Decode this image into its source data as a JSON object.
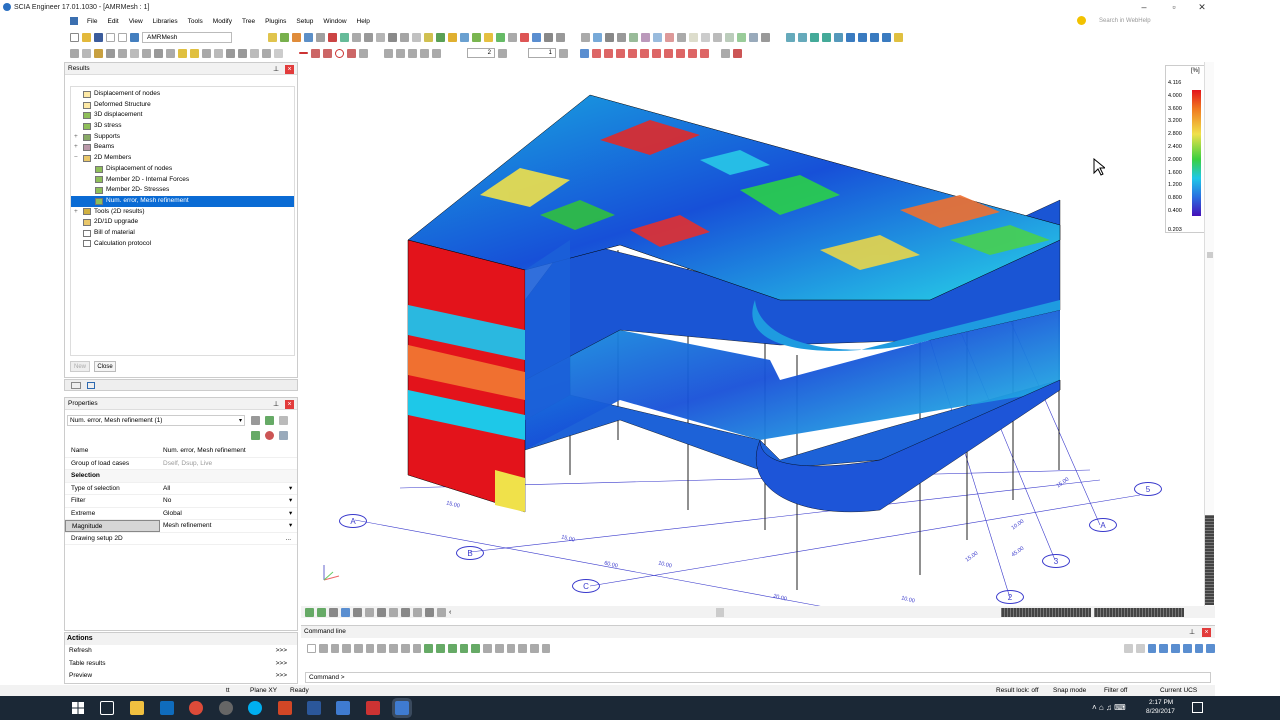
{
  "window": {
    "title": "SCIA Engineer 17.01.1030 - [AMRMesh : 1]",
    "min": "–",
    "max": "▫",
    "close": "✕"
  },
  "menu": [
    "File",
    "Edit",
    "View",
    "Libraries",
    "Tools",
    "Modify",
    "Tree",
    "Plugins",
    "Setup",
    "Window",
    "Help"
  ],
  "search": {
    "placeholder": "Search in WebHelp"
  },
  "toolbar": {
    "project_combo": "AMRMesh",
    "layer_value": "2",
    "grid_value": "1"
  },
  "results_panel": {
    "title": "Results",
    "items": [
      {
        "label": "Displacement of nodes",
        "indent": 1
      },
      {
        "label": "Deformed Structure",
        "indent": 1
      },
      {
        "label": "3D displacement",
        "indent": 1
      },
      {
        "label": "3D stress",
        "indent": 1
      },
      {
        "label": "Supports",
        "indent": 0,
        "exp": "+"
      },
      {
        "label": "Beams",
        "indent": 0,
        "exp": "+"
      },
      {
        "label": "2D Members",
        "indent": 0,
        "exp": "−"
      },
      {
        "label": "Displacement of nodes",
        "indent": 2
      },
      {
        "label": "Member 2D - Internal Forces",
        "indent": 2
      },
      {
        "label": "Member 2D- Stresses",
        "indent": 2
      },
      {
        "label": "Num. error, Mesh refinement",
        "indent": 2,
        "selected": true
      },
      {
        "label": "Tools (2D results)",
        "indent": 0,
        "exp": "+"
      },
      {
        "label": "2D/1D upgrade",
        "indent": 1
      },
      {
        "label": "Bill of material",
        "indent": 1
      },
      {
        "label": "Calculation protocol",
        "indent": 1
      }
    ],
    "new_label": "New",
    "close_label": "Close"
  },
  "properties_panel": {
    "title": "Properties",
    "selector": "Num. error, Mesh refinement (1)",
    "rows": [
      {
        "k": "Name",
        "v": "Num. error, Mesh refinement"
      },
      {
        "k": "Group of load cases",
        "v": "Dself, Dsup, Live",
        "muted": true
      }
    ],
    "section": "Selection",
    "sel_rows": [
      {
        "k": "Type of selection",
        "v": "All"
      },
      {
        "k": "Filter",
        "v": "No"
      },
      {
        "k": "Extreme",
        "v": "Global"
      },
      {
        "k": "Magnitude",
        "v": "Mesh refinement",
        "hl": true
      }
    ],
    "drawing": "Drawing setup 2D",
    "drawing_btn": "..."
  },
  "actions_panel": {
    "title": "Actions",
    "items": [
      {
        "label": "Refresh",
        "arrow": ">>>"
      },
      {
        "label": "Table results",
        "arrow": ">>>"
      },
      {
        "label": "Preview",
        "arrow": ">>>"
      }
    ]
  },
  "legend": {
    "unit": "[%]",
    "values": [
      "4.116",
      "4.000",
      "3.600",
      "3.200",
      "2.800",
      "2.400",
      "2.000",
      "1.600",
      "1.200",
      "0.800",
      "0.400",
      "0.203"
    ]
  },
  "grid_labels": {
    "letters": [
      "A",
      "B",
      "C",
      "A"
    ],
    "numbers": [
      "5",
      "3",
      "2"
    ],
    "dims": [
      "15.00",
      "15.00",
      "60.00",
      "10.00",
      "20.00",
      "10.00",
      "15.00",
      "10.00",
      "45.00",
      "15.00"
    ]
  },
  "command": {
    "title": "Command line",
    "prompt": "Command >"
  },
  "status": {
    "left_icon": "tt",
    "plane": "Plane XY",
    "state": "Ready",
    "lock": "Result lock: off",
    "snap": "Snap mode",
    "filter": "Filter off",
    "ucs": "Current UCS"
  },
  "clock": {
    "time": "2:17 PM",
    "date": "8/29/2017"
  },
  "colors": {
    "selection": "#0a6bd4",
    "legend_red": "#e3131b",
    "legend_blue": "#1e2ad8",
    "panel_red": "#e23c3c"
  }
}
